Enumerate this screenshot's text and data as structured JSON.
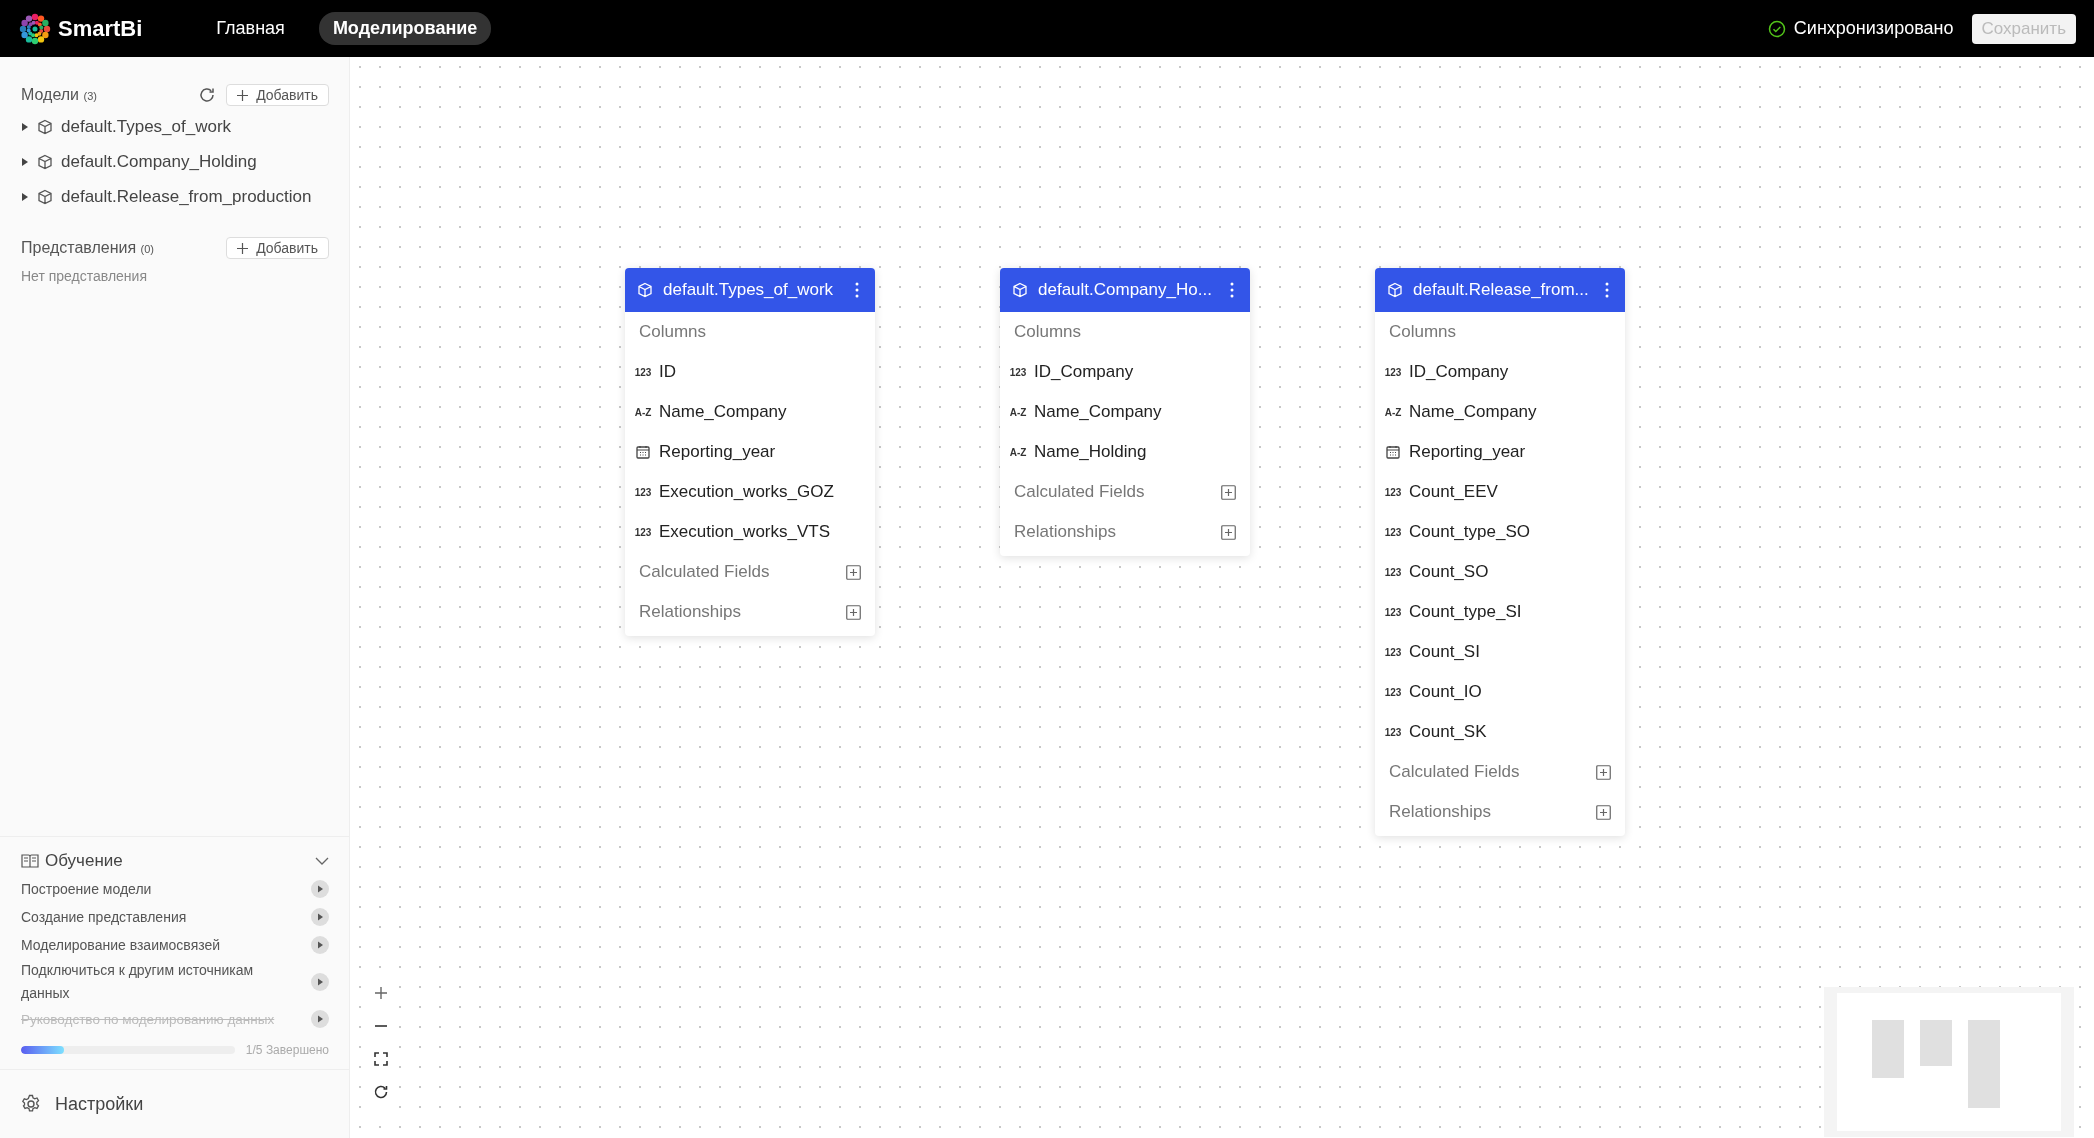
{
  "header": {
    "logo": "SmartBi",
    "tabs": [
      {
        "label": "Главная",
        "selected": false
      },
      {
        "label": "Моделирование",
        "selected": true
      }
    ],
    "sync_status": "Синхронизировано",
    "save_button": {
      "label": "Сохранить",
      "disabled": true
    }
  },
  "sidebar": {
    "models": {
      "title": "Модели",
      "count": "(3)",
      "add_button": "Добавить",
      "items": [
        {
          "label": "default.Types_of_work",
          "expanded": false
        },
        {
          "label": "default.Company_Holding",
          "expanded": false
        },
        {
          "label": "default.Release_from_production",
          "expanded": false
        }
      ]
    },
    "views": {
      "title": "Представления",
      "count": "(0)",
      "add_button": "Добавить",
      "empty_text": "Нет представления"
    },
    "learning": {
      "title": "Обучение",
      "expanded": true,
      "items": [
        {
          "label": "Построение модели",
          "done": false
        },
        {
          "label": "Создание представления",
          "done": false
        },
        {
          "label": "Моделирование взаимосвязей",
          "done": false
        },
        {
          "label": "Подключиться к другим источникам данных",
          "done": false
        },
        {
          "label": "Руководство по моделированию данных",
          "done": true
        }
      ],
      "progress": {
        "level": 0.2,
        "text": "1/5 Завершено"
      }
    },
    "settings": "Настройки"
  },
  "canvas": {
    "models": [
      {
        "title": "default.Types_of_work",
        "columns_label": "Columns",
        "columns": [
          {
            "name": "ID",
            "kind": "number",
            "type_label": "123"
          },
          {
            "name": "Name_Company",
            "kind": "text",
            "type_label": "A-Z"
          },
          {
            "name": "Reporting_year",
            "kind": "date"
          },
          {
            "name": "Execution_works_GOZ",
            "kind": "number",
            "type_label": "123"
          },
          {
            "name": "Execution_works_VTS",
            "kind": "number",
            "type_label": "123"
          }
        ],
        "sections": [
          "Calculated Fields",
          "Relationships"
        ]
      },
      {
        "title": "default.Company_Ho...",
        "columns_label": "Columns",
        "columns": [
          {
            "name": "ID_Company",
            "kind": "number",
            "type_label": "123"
          },
          {
            "name": "Name_Company",
            "kind": "text",
            "type_label": "A-Z"
          },
          {
            "name": "Name_Holding",
            "kind": "text",
            "type_label": "A-Z"
          }
        ],
        "sections": [
          "Calculated Fields",
          "Relationships"
        ]
      },
      {
        "title": "default.Release_from...",
        "columns_label": "Columns",
        "columns": [
          {
            "name": "ID_Company",
            "kind": "number",
            "type_label": "123"
          },
          {
            "name": "Name_Company",
            "kind": "text",
            "type_label": "A-Z"
          },
          {
            "name": "Reporting_year",
            "kind": "date"
          },
          {
            "name": "Count_EEV",
            "kind": "number",
            "type_label": "123"
          },
          {
            "name": "Count_type_SO",
            "kind": "number",
            "type_label": "123"
          },
          {
            "name": "Count_SO",
            "kind": "number",
            "type_label": "123"
          },
          {
            "name": "Count_type_SI",
            "kind": "number",
            "type_label": "123"
          },
          {
            "name": "Count_SI",
            "kind": "number",
            "type_label": "123"
          },
          {
            "name": "Count_IO",
            "kind": "number",
            "type_label": "123"
          },
          {
            "name": "Count_SK",
            "kind": "number",
            "type_label": "123"
          }
        ],
        "sections": [
          "Calculated Fields",
          "Relationships"
        ]
      }
    ]
  }
}
